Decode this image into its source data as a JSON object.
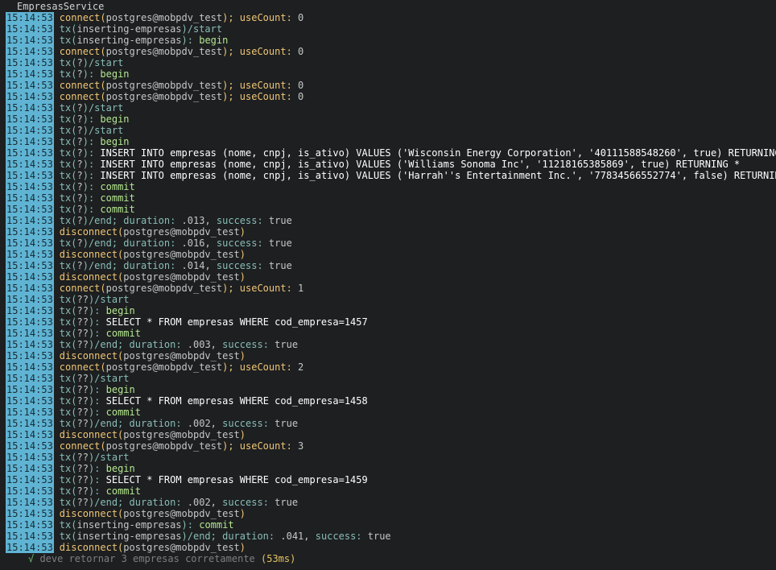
{
  "suite_title": "EmpresasService",
  "lines": [
    {
      "time": "15:14:53",
      "parts": [
        [
          "connect(",
          "connect"
        ],
        [
          "postgres@mobpdv_test",
          "arg"
        ],
        [
          "); ",
          "connect"
        ],
        [
          "useCount:",
          "key"
        ],
        [
          " 0",
          "num"
        ]
      ]
    },
    {
      "time": "15:14:53",
      "parts": [
        [
          "tx(",
          "tx"
        ],
        [
          "inserting-empresas",
          "arg"
        ],
        [
          ")/start",
          "start"
        ]
      ]
    },
    {
      "time": "15:14:53",
      "parts": [
        [
          "tx(",
          "tx"
        ],
        [
          "inserting-empresas",
          "arg"
        ],
        [
          "): ",
          "tx"
        ],
        [
          "begin",
          "begin"
        ]
      ]
    },
    {
      "time": "15:14:53",
      "parts": [
        [
          "connect(",
          "connect"
        ],
        [
          "postgres@mobpdv_test",
          "arg"
        ],
        [
          "); ",
          "connect"
        ],
        [
          "useCount:",
          "key"
        ],
        [
          " 0",
          "num"
        ]
      ]
    },
    {
      "time": "15:14:53",
      "parts": [
        [
          "tx(",
          "tx"
        ],
        [
          "?",
          "arg"
        ],
        [
          ")/start",
          "start"
        ]
      ]
    },
    {
      "time": "15:14:53",
      "parts": [
        [
          "tx(",
          "tx"
        ],
        [
          "?",
          "arg"
        ],
        [
          "): ",
          "tx"
        ],
        [
          "begin",
          "begin"
        ]
      ]
    },
    {
      "time": "15:14:53",
      "parts": [
        [
          "connect(",
          "connect"
        ],
        [
          "postgres@mobpdv_test",
          "arg"
        ],
        [
          "); ",
          "connect"
        ],
        [
          "useCount:",
          "key"
        ],
        [
          " 0",
          "num"
        ]
      ]
    },
    {
      "time": "15:14:53",
      "parts": [
        [
          "connect(",
          "connect"
        ],
        [
          "postgres@mobpdv_test",
          "arg"
        ],
        [
          "); ",
          "connect"
        ],
        [
          "useCount:",
          "key"
        ],
        [
          " 0",
          "num"
        ]
      ]
    },
    {
      "time": "15:14:53",
      "parts": [
        [
          "tx(",
          "tx"
        ],
        [
          "?",
          "arg"
        ],
        [
          ")/start",
          "start"
        ]
      ]
    },
    {
      "time": "15:14:53",
      "parts": [
        [
          "tx(",
          "tx"
        ],
        [
          "?",
          "arg"
        ],
        [
          "): ",
          "tx"
        ],
        [
          "begin",
          "begin"
        ]
      ]
    },
    {
      "time": "15:14:53",
      "parts": [
        [
          "tx(",
          "tx"
        ],
        [
          "?",
          "arg"
        ],
        [
          ")/start",
          "start"
        ]
      ]
    },
    {
      "time": "15:14:53",
      "parts": [
        [
          "tx(",
          "tx"
        ],
        [
          "?",
          "arg"
        ],
        [
          "): ",
          "tx"
        ],
        [
          "begin",
          "begin"
        ]
      ]
    },
    {
      "time": "15:14:53",
      "parts": [
        [
          "tx(",
          "tx"
        ],
        [
          "?",
          "arg"
        ],
        [
          "): ",
          "tx"
        ],
        [
          "INSERT INTO empresas (nome, cnpj, is_ativo) VALUES ('Wisconsin Energy Corporation', '40111588548260', true) RETURNING *",
          "sql"
        ]
      ]
    },
    {
      "time": "15:14:53",
      "parts": [
        [
          "tx(",
          "tx"
        ],
        [
          "?",
          "arg"
        ],
        [
          "): ",
          "tx"
        ],
        [
          "INSERT INTO empresas (nome, cnpj, is_ativo) VALUES ('Williams Sonoma Inc', '11218165385869', true) RETURNING *",
          "sql"
        ]
      ]
    },
    {
      "time": "15:14:53",
      "parts": [
        [
          "tx(",
          "tx"
        ],
        [
          "?",
          "arg"
        ],
        [
          "): ",
          "tx"
        ],
        [
          "INSERT INTO empresas (nome, cnpj, is_ativo) VALUES ('Harrah''s Entertainment Inc.', '77834566552774', false) RETURNING *",
          "sql"
        ]
      ]
    },
    {
      "time": "15:14:53",
      "parts": [
        [
          "tx(",
          "tx"
        ],
        [
          "?",
          "arg"
        ],
        [
          "): ",
          "tx"
        ],
        [
          "commit",
          "commit"
        ]
      ]
    },
    {
      "time": "15:14:53",
      "parts": [
        [
          "tx(",
          "tx"
        ],
        [
          "?",
          "arg"
        ],
        [
          "): ",
          "tx"
        ],
        [
          "commit",
          "commit"
        ]
      ]
    },
    {
      "time": "15:14:53",
      "parts": [
        [
          "tx(",
          "tx"
        ],
        [
          "?",
          "arg"
        ],
        [
          "): ",
          "tx"
        ],
        [
          "commit",
          "commit"
        ]
      ]
    },
    {
      "time": "15:14:53",
      "parts": [
        [
          "tx(",
          "tx"
        ],
        [
          "?",
          "arg"
        ],
        [
          ")/end; ",
          "tx"
        ],
        [
          "duration:",
          "txkey"
        ],
        [
          " .013, ",
          "num"
        ],
        [
          "success:",
          "txkey"
        ],
        [
          " true",
          "num"
        ]
      ]
    },
    {
      "time": "15:14:53",
      "parts": [
        [
          "disconnect(",
          "disconnect"
        ],
        [
          "postgres@mobpdv_test",
          "arg"
        ],
        [
          ")",
          "disconnect"
        ]
      ]
    },
    {
      "time": "15:14:53",
      "parts": [
        [
          "tx(",
          "tx"
        ],
        [
          "?",
          "arg"
        ],
        [
          ")/end; ",
          "tx"
        ],
        [
          "duration:",
          "txkey"
        ],
        [
          " .016, ",
          "num"
        ],
        [
          "success:",
          "txkey"
        ],
        [
          " true",
          "num"
        ]
      ]
    },
    {
      "time": "15:14:53",
      "parts": [
        [
          "disconnect(",
          "disconnect"
        ],
        [
          "postgres@mobpdv_test",
          "arg"
        ],
        [
          ")",
          "disconnect"
        ]
      ]
    },
    {
      "time": "15:14:53",
      "parts": [
        [
          "tx(",
          "tx"
        ],
        [
          "?",
          "arg"
        ],
        [
          ")/end; ",
          "tx"
        ],
        [
          "duration:",
          "txkey"
        ],
        [
          " .014, ",
          "num"
        ],
        [
          "success:",
          "txkey"
        ],
        [
          " true",
          "num"
        ]
      ]
    },
    {
      "time": "15:14:53",
      "parts": [
        [
          "disconnect(",
          "disconnect"
        ],
        [
          "postgres@mobpdv_test",
          "arg"
        ],
        [
          ")",
          "disconnect"
        ]
      ]
    },
    {
      "time": "15:14:53",
      "parts": [
        [
          "connect(",
          "connect"
        ],
        [
          "postgres@mobpdv_test",
          "arg"
        ],
        [
          "); ",
          "connect"
        ],
        [
          "useCount:",
          "key"
        ],
        [
          " 1",
          "num"
        ]
      ]
    },
    {
      "time": "15:14:53",
      "parts": [
        [
          "tx(",
          "tx"
        ],
        [
          "??",
          "arg"
        ],
        [
          ")/start",
          "start"
        ]
      ]
    },
    {
      "time": "15:14:53",
      "parts": [
        [
          "tx(",
          "tx"
        ],
        [
          "??",
          "arg"
        ],
        [
          "): ",
          "tx"
        ],
        [
          "begin",
          "begin"
        ]
      ]
    },
    {
      "time": "15:14:53",
      "parts": [
        [
          "tx(",
          "tx"
        ],
        [
          "??",
          "arg"
        ],
        [
          "): ",
          "tx"
        ],
        [
          "SELECT * FROM empresas WHERE cod_empresa=1457",
          "sql"
        ]
      ]
    },
    {
      "time": "15:14:53",
      "parts": [
        [
          "tx(",
          "tx"
        ],
        [
          "??",
          "arg"
        ],
        [
          "): ",
          "tx"
        ],
        [
          "commit",
          "commit"
        ]
      ]
    },
    {
      "time": "15:14:53",
      "parts": [
        [
          "tx(",
          "tx"
        ],
        [
          "??",
          "arg"
        ],
        [
          ")/end; ",
          "tx"
        ],
        [
          "duration:",
          "txkey"
        ],
        [
          " .003, ",
          "num"
        ],
        [
          "success:",
          "txkey"
        ],
        [
          " true",
          "num"
        ]
      ]
    },
    {
      "time": "15:14:53",
      "parts": [
        [
          "disconnect(",
          "disconnect"
        ],
        [
          "postgres@mobpdv_test",
          "arg"
        ],
        [
          ")",
          "disconnect"
        ]
      ]
    },
    {
      "time": "15:14:53",
      "parts": [
        [
          "connect(",
          "connect"
        ],
        [
          "postgres@mobpdv_test",
          "arg"
        ],
        [
          "); ",
          "connect"
        ],
        [
          "useCount:",
          "key"
        ],
        [
          " 2",
          "num"
        ]
      ]
    },
    {
      "time": "15:14:53",
      "parts": [
        [
          "tx(",
          "tx"
        ],
        [
          "??",
          "arg"
        ],
        [
          ")/start",
          "start"
        ]
      ]
    },
    {
      "time": "15:14:53",
      "parts": [
        [
          "tx(",
          "tx"
        ],
        [
          "??",
          "arg"
        ],
        [
          "): ",
          "tx"
        ],
        [
          "begin",
          "begin"
        ]
      ]
    },
    {
      "time": "15:14:53",
      "parts": [
        [
          "tx(",
          "tx"
        ],
        [
          "??",
          "arg"
        ],
        [
          "): ",
          "tx"
        ],
        [
          "SELECT * FROM empresas WHERE cod_empresa=1458",
          "sql"
        ]
      ]
    },
    {
      "time": "15:14:53",
      "parts": [
        [
          "tx(",
          "tx"
        ],
        [
          "??",
          "arg"
        ],
        [
          "): ",
          "tx"
        ],
        [
          "commit",
          "commit"
        ]
      ]
    },
    {
      "time": "15:14:53",
      "parts": [
        [
          "tx(",
          "tx"
        ],
        [
          "??",
          "arg"
        ],
        [
          ")/end; ",
          "tx"
        ],
        [
          "duration:",
          "txkey"
        ],
        [
          " .002, ",
          "num"
        ],
        [
          "success:",
          "txkey"
        ],
        [
          " true",
          "num"
        ]
      ]
    },
    {
      "time": "15:14:53",
      "parts": [
        [
          "disconnect(",
          "disconnect"
        ],
        [
          "postgres@mobpdv_test",
          "arg"
        ],
        [
          ")",
          "disconnect"
        ]
      ]
    },
    {
      "time": "15:14:53",
      "parts": [
        [
          "connect(",
          "connect"
        ],
        [
          "postgres@mobpdv_test",
          "arg"
        ],
        [
          "); ",
          "connect"
        ],
        [
          "useCount:",
          "key"
        ],
        [
          " 3",
          "num"
        ]
      ]
    },
    {
      "time": "15:14:53",
      "parts": [
        [
          "tx(",
          "tx"
        ],
        [
          "??",
          "arg"
        ],
        [
          ")/start",
          "start"
        ]
      ]
    },
    {
      "time": "15:14:53",
      "parts": [
        [
          "tx(",
          "tx"
        ],
        [
          "??",
          "arg"
        ],
        [
          "): ",
          "tx"
        ],
        [
          "begin",
          "begin"
        ]
      ]
    },
    {
      "time": "15:14:53",
      "parts": [
        [
          "tx(",
          "tx"
        ],
        [
          "??",
          "arg"
        ],
        [
          "): ",
          "tx"
        ],
        [
          "SELECT * FROM empresas WHERE cod_empresa=1459",
          "sql"
        ]
      ]
    },
    {
      "time": "15:14:53",
      "parts": [
        [
          "tx(",
          "tx"
        ],
        [
          "??",
          "arg"
        ],
        [
          "): ",
          "tx"
        ],
        [
          "commit",
          "commit"
        ]
      ]
    },
    {
      "time": "15:14:53",
      "parts": [
        [
          "tx(",
          "tx"
        ],
        [
          "??",
          "arg"
        ],
        [
          ")/end; ",
          "tx"
        ],
        [
          "duration:",
          "txkey"
        ],
        [
          " .002, ",
          "num"
        ],
        [
          "success:",
          "txkey"
        ],
        [
          " true",
          "num"
        ]
      ]
    },
    {
      "time": "15:14:53",
      "parts": [
        [
          "disconnect(",
          "disconnect"
        ],
        [
          "postgres@mobpdv_test",
          "arg"
        ],
        [
          ")",
          "disconnect"
        ]
      ]
    },
    {
      "time": "15:14:53",
      "parts": [
        [
          "tx(",
          "tx"
        ],
        [
          "inserting-empresas",
          "arg"
        ],
        [
          "): ",
          "tx"
        ],
        [
          "commit",
          "commit"
        ]
      ]
    },
    {
      "time": "15:14:53",
      "parts": [
        [
          "tx(",
          "tx"
        ],
        [
          "inserting-empresas",
          "arg"
        ],
        [
          ")/end; ",
          "tx"
        ],
        [
          "duration:",
          "txkey"
        ],
        [
          " .041, ",
          "num"
        ],
        [
          "success:",
          "txkey"
        ],
        [
          " true",
          "num"
        ]
      ]
    },
    {
      "time": "15:14:53",
      "parts": [
        [
          "disconnect(",
          "disconnect"
        ],
        [
          "postgres@mobpdv_test",
          "arg"
        ],
        [
          ")",
          "disconnect"
        ]
      ]
    }
  ],
  "result": {
    "check": "√",
    "text": " deve retornar 3 empresas corretamente ",
    "duration": "(53ms)"
  },
  "colors": {
    "background": "#1d1f21",
    "timestamp_bg": "#5fb4d4",
    "connect": "#f0c674",
    "tx": "#8abeb7",
    "begin_commit": "#b5e890",
    "sql": "#ffffff",
    "pass_check": "#6fbf73"
  }
}
